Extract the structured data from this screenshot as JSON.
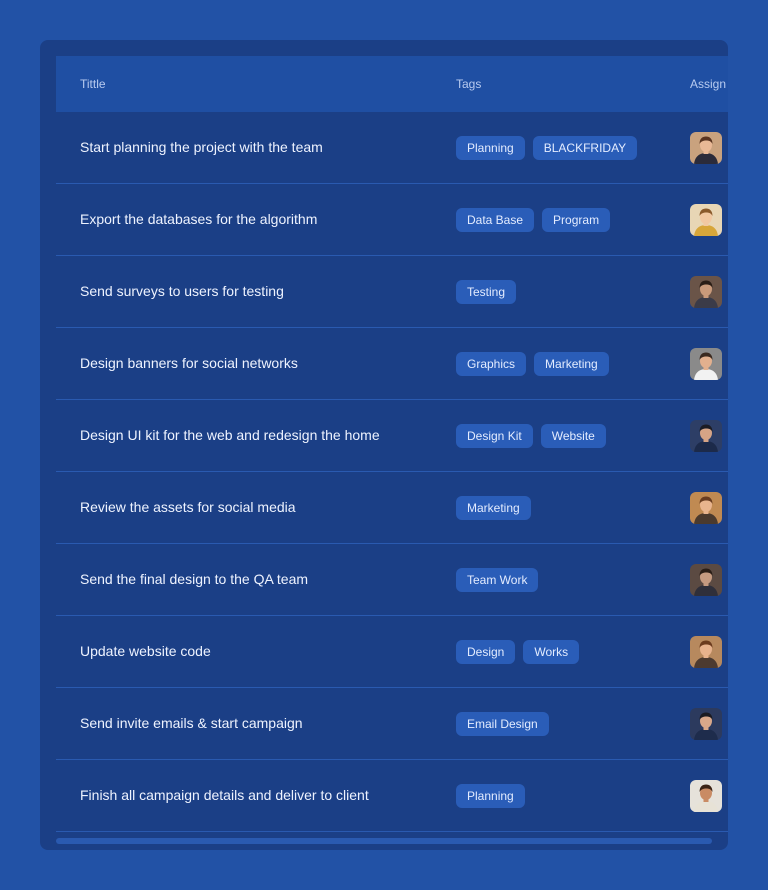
{
  "table": {
    "columns": {
      "title": "Tittle",
      "tags": "Tags",
      "assign": "Assign"
    },
    "rows": [
      {
        "title": "Start planning the project with the team",
        "tags": [
          "Planning",
          "BLACKFRIDAY"
        ],
        "avatar": {
          "skin": "#e9b896",
          "hair": "#5a3420",
          "shirt": "#2b2b3a",
          "bg": "#c9a27e"
        }
      },
      {
        "title": "Export the databases for the algorithm",
        "tags": [
          "Data Base",
          "Program"
        ],
        "avatar": {
          "skin": "#f1c8a2",
          "hair": "#8a5a2c",
          "shirt": "#d7a63a",
          "bg": "#e8d6b5"
        }
      },
      {
        "title": "Send surveys to users for testing",
        "tags": [
          "Testing"
        ],
        "avatar": {
          "skin": "#c99a7b",
          "hair": "#2a1d16",
          "shirt": "#3b3b48",
          "bg": "#6a5448"
        }
      },
      {
        "title": "Design banners for social networks",
        "tags": [
          "Graphics",
          "Marketing"
        ],
        "avatar": {
          "skin": "#e2b08e",
          "hair": "#3a2a20",
          "shirt": "#f2f2f2",
          "bg": "#8a8a8a"
        }
      },
      {
        "title": "Design UI kit for the web and redesign the home",
        "tags": [
          "Design Kit",
          "Website"
        ],
        "avatar": {
          "skin": "#d6a486",
          "hair": "#1c1c24",
          "shirt": "#1c2a4a",
          "bg": "#2d3e66"
        }
      },
      {
        "title": "Review the assets for social media",
        "tags": [
          "Marketing"
        ],
        "avatar": {
          "skin": "#e8b48e",
          "hair": "#6a3d20",
          "shirt": "#4a3a2e",
          "bg": "#c08a52"
        }
      },
      {
        "title": "Send the final design to the QA team",
        "tags": [
          "Team Work"
        ],
        "avatar": {
          "skin": "#c59a80",
          "hair": "#2a1d16",
          "shirt": "#2f2f3a",
          "bg": "#5b4a42"
        }
      },
      {
        "title": "Update website code",
        "tags": [
          "Design",
          "Works"
        ],
        "avatar": {
          "skin": "#e7b28d",
          "hair": "#6b3b1e",
          "shirt": "#4c3a30",
          "bg": "#b7895e"
        }
      },
      {
        "title": "Send invite emails & start campaign",
        "tags": [
          "Email Design"
        ],
        "avatar": {
          "skin": "#d9a88a",
          "hair": "#1b1b22",
          "shirt": "#1e2c4c",
          "bg": "#2c3a5e"
        }
      },
      {
        "title": "Finish all campaign details and deliver to client",
        "tags": [
          "Planning"
        ],
        "avatar": {
          "skin": "#c98b64",
          "hair": "#3b2416",
          "shirt": "#e7e2d6",
          "bg": "#e6e2da"
        }
      }
    ]
  },
  "colors": {
    "page_background": "#2252a6",
    "panel_background": "#1b3f86",
    "header_background": "#1f4fa3",
    "tag_background": "#2a5db8",
    "row_divider": "#2a5ab0"
  }
}
